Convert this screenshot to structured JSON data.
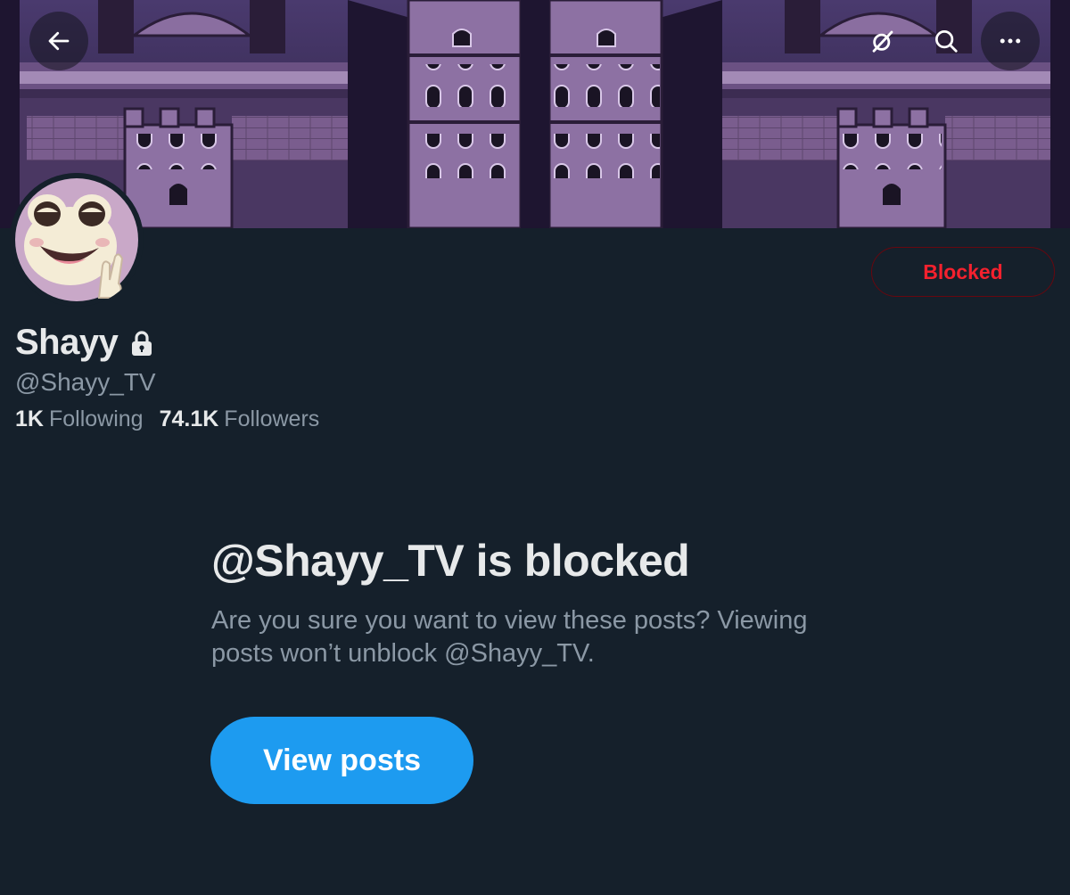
{
  "header": {
    "back_icon": "arrow-left-icon",
    "grok_icon": "grok-icon",
    "search_icon": "search-icon",
    "more_icon": "more-icon"
  },
  "profile": {
    "display_name": "Shayy",
    "handle": "@Shayy_TV",
    "protected_icon": "lock-icon",
    "following_count": "1K",
    "following_label": "Following",
    "followers_count": "74.1K",
    "followers_label": "Followers",
    "blocked_button_label": "Blocked"
  },
  "blocked_notice": {
    "title": "@Shayy_TV is blocked",
    "description": "Are you sure you want to view these posts? Viewing posts won’t unblock @Shayy_TV.",
    "view_posts_label": "View posts"
  },
  "colors": {
    "background": "#15202b",
    "accent": "#1d9bf0",
    "blocked_red": "#f4212e",
    "secondary_text": "#8b98a5"
  }
}
